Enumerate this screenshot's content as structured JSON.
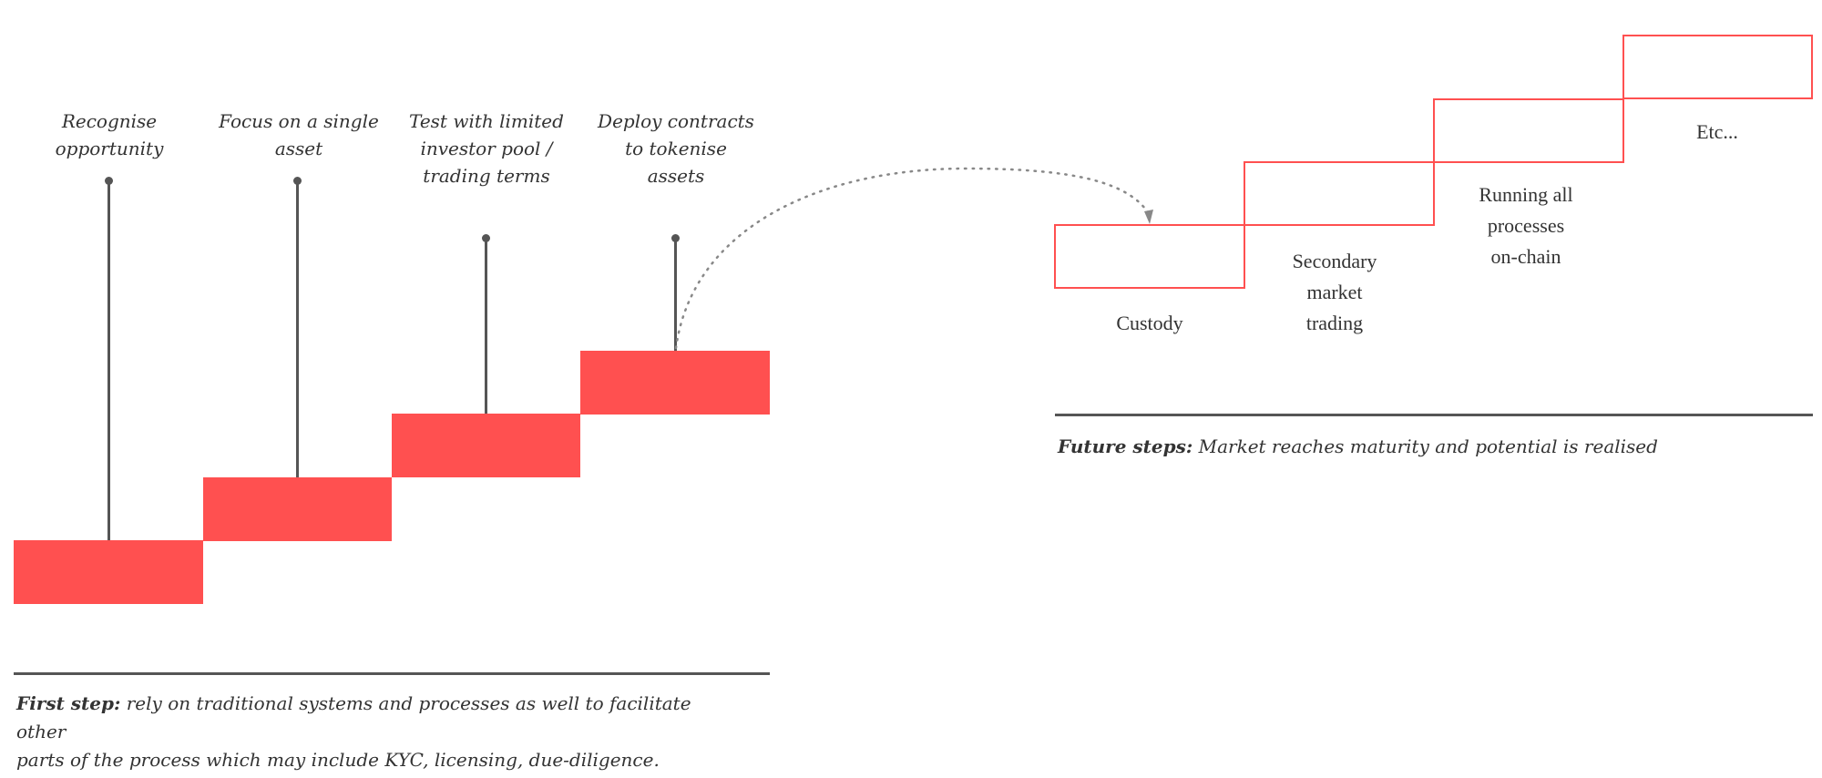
{
  "accent_color": "#ff5050",
  "line_color": "#555555",
  "first_steps": [
    {
      "label": "Recognise\nopportunity"
    },
    {
      "label": "Focus on a single\nasset"
    },
    {
      "label": "Test with limited\ninvestor pool /\ntrading terms"
    },
    {
      "label": "Deploy contracts\nto tokenise\nassets"
    }
  ],
  "future_steps": [
    {
      "label": "Custody"
    },
    {
      "label": "Secondary\nmarket\ntrading"
    },
    {
      "label": "Running all\nprocesses\non-chain"
    },
    {
      "label": "Etc..."
    }
  ],
  "captions": {
    "first": {
      "title": "First step:",
      "body": " rely on traditional systems and processes as well to facilitate other\nparts of the process which may include KYC, licensing, due-diligence."
    },
    "future": {
      "title": "Future steps:",
      "body": " Market reaches maturity and potential is realised"
    }
  }
}
